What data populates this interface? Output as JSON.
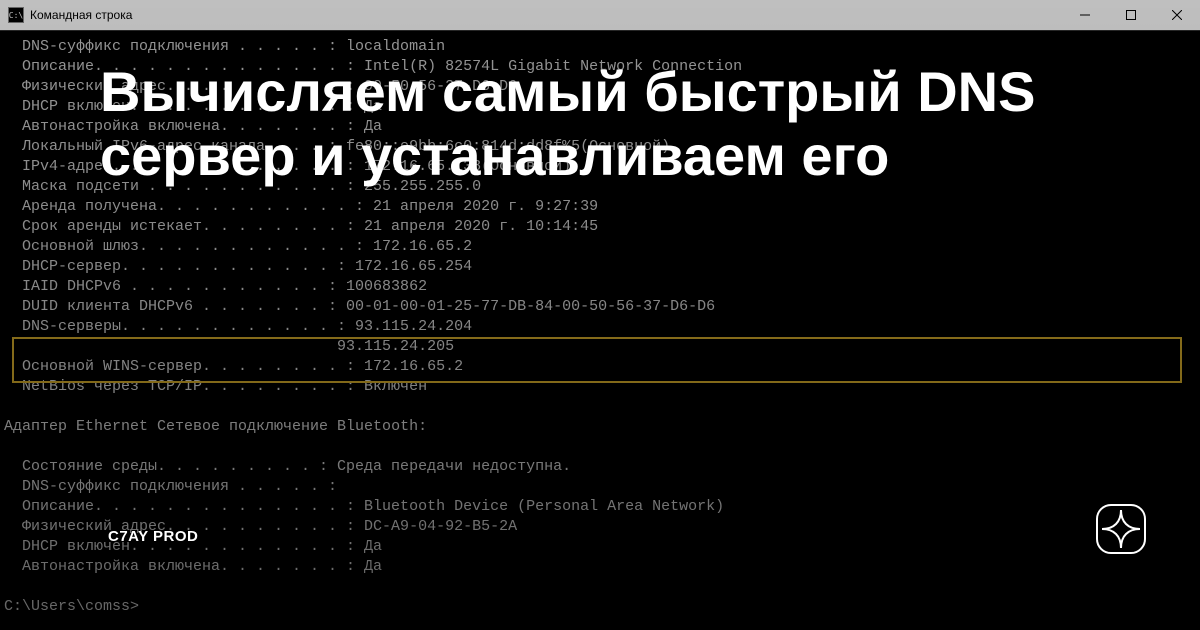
{
  "window": {
    "title": "Командная строка"
  },
  "console": {
    "lines": [
      {
        "label": "DNS-суффикс подключения",
        "dots": " . . . . . ",
        "value": "localdomain"
      },
      {
        "label": "Описание.",
        "dots": " . . . . . . . . . . . . . ",
        "value": "Intel(R) 82574L Gigabit Network Connection"
      },
      {
        "label": "Физический адрес.",
        "dots": " . . . . . . . . . ",
        "value": "00-50-56-37-D6-D6"
      },
      {
        "label": "DHCP включен.",
        "dots": " . . . . . . . . . . . ",
        "value": "Да"
      },
      {
        "label": "Автонастройка включена.",
        "dots": " . . . . . . ",
        "value": "Да"
      },
      {
        "label": "Локальный IPv6-адрес канала",
        "dots": " . . . ",
        "value": "fe80::e9bb:6c0:814d:dd8f%5(Основной)"
      },
      {
        "label": "IPv4-адрес.",
        "dots": " . . . . . . . . . . . . ",
        "value": "172.16.65.138(Основной)"
      },
      {
        "label": "Маска подсети",
        "dots": " . . . . . . . . . . . ",
        "value": "255.255.255.0"
      },
      {
        "label": "Аренда получена.",
        "dots": " . . . . . . . . . . ",
        "value": "21 апреля 2020 г. 9:27:39"
      },
      {
        "label": "Срок аренды истекает.",
        "dots": " . . . . . . . ",
        "value": "21 апреля 2020 г. 10:14:45"
      },
      {
        "label": "Основной шлюз.",
        "dots": " . . . . . . . . . . . ",
        "value": "172.16.65.2"
      },
      {
        "label": "DHCP-сервер.",
        "dots": " . . . . . . . . . . . ",
        "value": "172.16.65.254"
      },
      {
        "label": "IAID DHCPv6",
        "dots": " . . . . . . . . . . . ",
        "value": "100683862"
      },
      {
        "label": "DUID клиента DHCPv6",
        "dots": " . . . . . . . ",
        "value": "00-01-00-01-25-77-DB-84-00-50-56-37-D6-D6"
      },
      {
        "label": "DNS-серверы.",
        "dots": " . . . . . . . . . . . ",
        "value": "93.115.24.204"
      },
      {
        "label": "",
        "dots": "                                   ",
        "value": "93.115.24.205"
      },
      {
        "label": "Основной WINS-сервер.",
        "dots": " . . . . . . . ",
        "value": "172.16.65.2"
      },
      {
        "label": "NetBios через TCP/IP.",
        "dots": " . . . . . . . ",
        "value": "Включен"
      }
    ],
    "adapter_header": "Адаптер Ethernet Сетевое подключение Bluetooth:",
    "lines2": [
      {
        "label": "Состояние среды.",
        "dots": " . . . . . . . . ",
        "value": "Среда передачи недоступна."
      },
      {
        "label": "DNS-суффикс подключения",
        "dots": " . . . . . ",
        "value": ""
      },
      {
        "label": "Описание.",
        "dots": " . . . . . . . . . . . . . ",
        "value": "Bluetooth Device (Personal Area Network)"
      },
      {
        "label": "Физический адрес.",
        "dots": " . . . . . . . . . ",
        "value": "DC-A9-04-92-B5-2A"
      },
      {
        "label": "DHCP включен.",
        "dots": " . . . . . . . . . . . ",
        "value": "Да"
      },
      {
        "label": "Автонастройка включена.",
        "dots": " . . . . . . ",
        "value": "Да"
      }
    ],
    "prompt": "C:\\Users\\comss>"
  },
  "overlay": {
    "headline": "Вычисляем самый быстрый DNS сервер и устанавливаем его",
    "author": "C7AY PROD"
  }
}
